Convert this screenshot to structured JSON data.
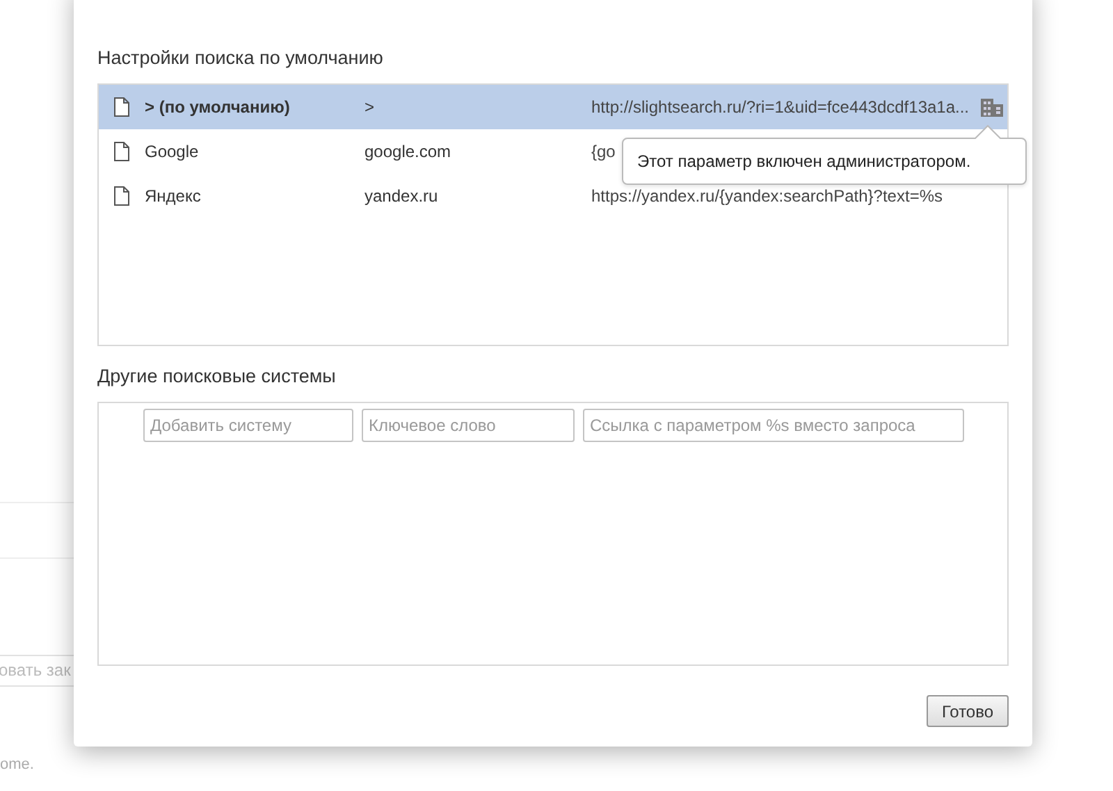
{
  "background": {
    "field_text": "овать зак",
    "footer_text": "ome."
  },
  "dialog": {
    "default_section": {
      "heading": "Настройки поиска по умолчанию",
      "rows": [
        {
          "name": "> (по умолчанию)",
          "keyword": ">",
          "url": "http://slightsearch.ru/?ri=1&uid=fce443dcdf13a1a...",
          "selected": true,
          "managed": true
        },
        {
          "name": "Google",
          "keyword": "google.com",
          "url": "{go",
          "selected": false,
          "managed": false
        },
        {
          "name": "Яндекс",
          "keyword": "yandex.ru",
          "url": "https://yandex.ru/{yandex:searchPath}?text=%s",
          "selected": false,
          "managed": false
        }
      ]
    },
    "tooltip": "Этот параметр включен администратором.",
    "other_section": {
      "heading": "Другие поисковые системы",
      "inputs": [
        {
          "placeholder": "Добавить систему"
        },
        {
          "placeholder": "Ключевое слово"
        },
        {
          "placeholder": "Ссылка с параметром %s вместо запроса"
        }
      ]
    },
    "done_button": "Готово"
  }
}
